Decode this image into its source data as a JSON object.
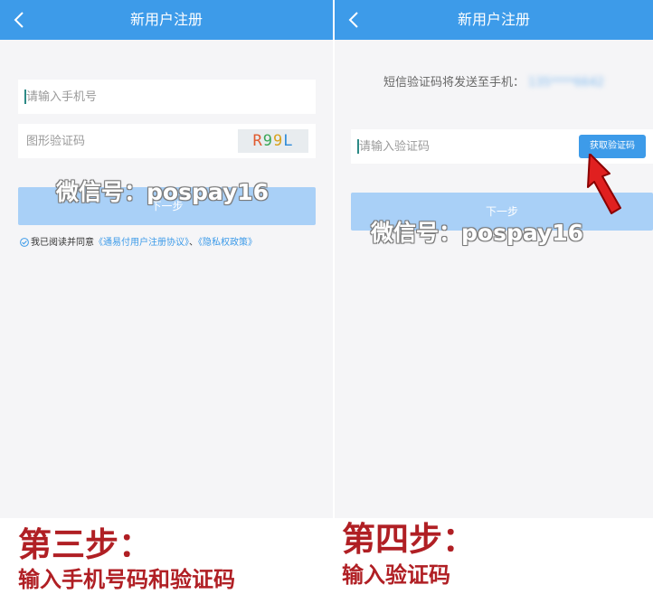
{
  "colors": {
    "nav_blue": "#3d9be9",
    "button_disabled": "#a9d0f7",
    "caption_red": "#b01f24",
    "arrow_red": "#e02020",
    "background": "#f5f5f7"
  },
  "left_screen": {
    "nav": {
      "title": "新用户注册",
      "back_icon": "chevron-left-icon"
    },
    "phone_field": {
      "placeholder": "请输入手机号",
      "value": ""
    },
    "captcha_field": {
      "placeholder": "图形验证码",
      "value": ""
    },
    "captcha_image": {
      "chars": [
        "R",
        "9",
        "9",
        "L"
      ],
      "colors": [
        "#e05b2f",
        "#3aa757",
        "#d9a21b",
        "#2f8bd8"
      ]
    },
    "next_button": "下一步",
    "agreement": {
      "checked": true,
      "prefix": "我已阅读并同意",
      "link_user_agreement": "《通易付用户注册协议》",
      "separator": "、",
      "link_privacy": "《隐私权政策》"
    },
    "watermark": "微信号：pospay16"
  },
  "right_screen": {
    "nav": {
      "title": "新用户注册",
      "back_icon": "chevron-left-icon"
    },
    "sms_hint": {
      "text": "短信验证码将发送至手机：",
      "phone_masked": "135****6642"
    },
    "code_field": {
      "placeholder": "请输入验证码",
      "value": ""
    },
    "get_code_button": "获取验证码",
    "next_button": "下一步",
    "watermark": "微信号：pospay16",
    "pointer": "red-arrow-icon"
  },
  "captions": {
    "step3_title": "第三步：",
    "step3_desc": "输入手机号码和验证码",
    "step4_title": "第四步：",
    "step4_desc": "输入验证码"
  }
}
